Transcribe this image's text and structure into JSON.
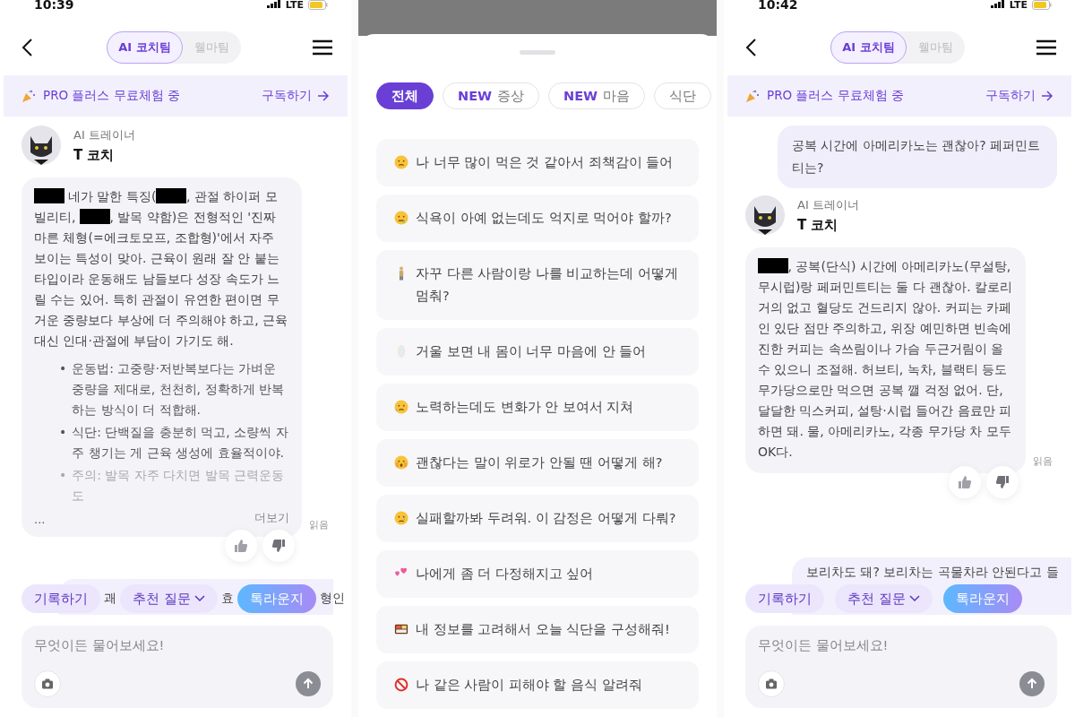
{
  "screens": [
    {
      "kind": "chat",
      "status_bar": {
        "time": "10:39",
        "network": "LTE"
      },
      "tabs": [
        {
          "label": "AI 코치팀",
          "selected": true
        },
        {
          "label": "웰마팀",
          "selected": false
        }
      ],
      "banner": {
        "text": "PRO 플러스 무료체험 중",
        "action": "구독하기"
      },
      "messages": [
        {
          "kind": "bot",
          "role": "AI 트레이너",
          "name": "T 코치",
          "segments": [
            {
              "kind": "redacted"
            },
            {
              "kind": "text",
              "text": " 네가 말한 특징("
            },
            {
              "kind": "redacted"
            },
            {
              "kind": "text",
              "text": ", 관절 하이퍼 모빌리티, "
            },
            {
              "kind": "redacted"
            },
            {
              "kind": "text",
              "text": ", 발목 약함)은 전형적인 '진짜 마른 체형(=에크토모프, 조합형)'에서 자주 보이는 특성이 맞아. 근육이 원래 잘 안 붙는 타입이라 운동해도 남들보다 성장 속도가 느릴 수는 있어. 특히 관절이 유연한 편이면 무거운 중량보다 부상에 더 주의해야 하고, 근육 대신 인대·관절에 부담이 가기도 해."
            }
          ],
          "bullets": [
            {
              "marker": "•",
              "text": "운동법: 고중량·저반복보다는 가벼운 중량을 제대로, 천천히, 정확하게 반복하는 방식이 더 적합해.",
              "faded": false
            },
            {
              "marker": "•",
              "text": "식단: 단백질을 충분히 먹고, 소량씩 자주 챙기는 게 근육 생성에 효율적이야.",
              "faded": false
            },
            {
              "marker": "•",
              "text": "주의: 발목 자주 다치면 발목 근력운동도",
              "faded": true
            }
          ],
          "ellipsis": "...",
          "more": "더보기",
          "receipt": "읽음"
        },
        {
          "kind": "partial",
          "fragments": [
            "괘",
            "효",
            "형인"
          ]
        }
      ],
      "quick_actions": [
        {
          "label": "기록하기",
          "kind": "plain"
        },
        {
          "label": "추천 질문",
          "kind": "dropdown"
        },
        {
          "label": "톡라운지",
          "kind": "gradient"
        }
      ],
      "input": {
        "placeholder": "무엇이든 물어보세요!"
      }
    },
    {
      "kind": "sheet",
      "filters": [
        {
          "label": "전체",
          "selected": true
        },
        {
          "badge": "NEW",
          "label": "증상",
          "selected": false
        },
        {
          "badge": "NEW",
          "label": "마음",
          "selected": false
        },
        {
          "label": "식단",
          "selected": false
        }
      ],
      "suggestions": [
        {
          "kind": "sad-face",
          "text": "나 너무 많이 먹은 것 같아서 죄책감이 들어"
        },
        {
          "kind": "queasy-face",
          "text": "식욕이 아예 없는데도 억지로 먹어야 할까?"
        },
        {
          "kind": "person",
          "text": "자꾸 다른 사람이랑 나를 비교하는데 어떻게 멈춰?"
        },
        {
          "kind": "mirror",
          "text": "거울 보면 내 몸이 너무 마음에 안 들어"
        },
        {
          "kind": "sweat-face",
          "text": "노력하는데도 변화가 안 보여서 지쳐"
        },
        {
          "kind": "shocked-face",
          "text": "괜찮다는 말이 위로가 안될 땐 어떻게 해?"
        },
        {
          "kind": "tear-face",
          "text": "실패할까봐 두려워. 이 감정은 어떻게 다뤄?"
        },
        {
          "kind": "hearts",
          "text": "나에게 좀 더 다정해지고 싶어"
        },
        {
          "kind": "bento",
          "text": "내 정보를 고려해서 오늘 식단을 구성해줘!"
        },
        {
          "kind": "prohibited",
          "text": "나 같은 사람이 피해야 할 음식 알려줘"
        }
      ]
    },
    {
      "kind": "chat",
      "status_bar": {
        "time": "10:42",
        "network": "LTE"
      },
      "tabs": [
        {
          "label": "AI 코치팀",
          "selected": true
        },
        {
          "label": "웰마팀",
          "selected": false
        }
      ],
      "banner": {
        "text": "PRO 플러스 무료체험 중",
        "action": "구독하기"
      },
      "messages": [
        {
          "kind": "user",
          "text": "공복 시간에 아메리카노는 괜찮아? 페퍼민트 티는?"
        },
        {
          "kind": "bot",
          "role": "AI 트레이너",
          "name": "T 코치",
          "segments": [
            {
              "kind": "redacted"
            },
            {
              "kind": "text",
              "text": ", 공복(단식) 시간에 아메리카노(무설탕, 무시럽)랑 페퍼민트티는 둘 다 괜찮아. 칼로리 거의 없고 혈당도 건드리지 않아. 커피는 카페인 있단 점만 주의하고, 위장 예민하면 빈속에 진한 커피는 속쓰림이나 가슴 두근거림이 올 수 있으니 조절해. 허브티, 녹차, 블랙티 등도 무가당으로만 먹으면 공복 깰 걱정 없어. 단, 달달한 믹스커피, 설탕·시럽 들어간 음료만 피하면 돼. 물, 아메리카노, 각종 무가당 차 모두 OK다."
            }
          ],
          "receipt": "읽음"
        },
        {
          "kind": "partial",
          "fragments": [
            "보리차도 돼? 보리차는 곡물차라 안된다고 들"
          ]
        }
      ],
      "quick_actions": [
        {
          "label": "기록하기",
          "kind": "plain"
        },
        {
          "label": "추천 질문",
          "kind": "dropdown"
        },
        {
          "label": "톡라운지",
          "kind": "gradient"
        }
      ],
      "input": {
        "placeholder": "무엇이든 물어보세요!"
      }
    }
  ]
}
